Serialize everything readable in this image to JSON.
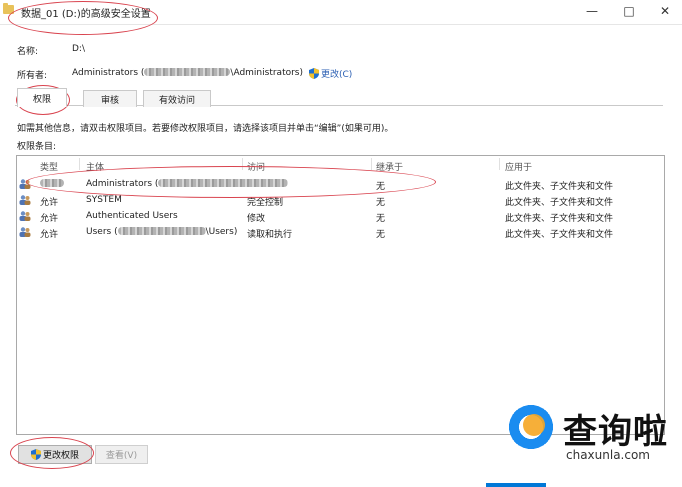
{
  "window": {
    "title": "数据_01 (D:)的高级安全设置",
    "minimize": "—",
    "maximize": "□",
    "close": "✕"
  },
  "info": {
    "name_label": "名称:",
    "name_value": "D:\\",
    "owner_label": "所有者:",
    "owner_prefix": "Administrators (",
    "owner_suffix": "\\Administrators)",
    "change_link": "更改(C)"
  },
  "tabs": [
    {
      "label": "权限",
      "active": true
    },
    {
      "label": "审核",
      "active": false
    },
    {
      "label": "有效访问",
      "active": false
    }
  ],
  "hint": "如需其他信息，请双击权限项目。若要修改权限项目，请选择该项目并单击“编辑”(如果可用)。",
  "entries_label": "权限条目:",
  "columns": [
    "类型",
    "主体",
    "访问",
    "继承于",
    "应用于"
  ],
  "rows": [
    {
      "type": "",
      "principal": "Administrators (",
      "principal_suffix": "",
      "access": "",
      "inherited": "无",
      "applies": "此文件夹、子文件夹和文件"
    },
    {
      "type": "允许",
      "principal": "SYSTEM",
      "principal_suffix": "",
      "access": "完全控制",
      "inherited": "无",
      "applies": "此文件夹、子文件夹和文件"
    },
    {
      "type": "允许",
      "principal": "Authenticated Users",
      "principal_suffix": "",
      "access": "修改",
      "inherited": "无",
      "applies": "此文件夹、子文件夹和文件"
    },
    {
      "type": "允许",
      "principal": "Users (",
      "principal_suffix": "\\Users)",
      "access": "读取和执行",
      "inherited": "无",
      "applies": "此文件夹、子文件夹和文件"
    }
  ],
  "buttons": {
    "change_permissions": "更改权限",
    "view": "查看(V)"
  },
  "watermark": {
    "text": "查询啦",
    "sub": "chaxunla.com"
  },
  "colors": {
    "annotation": "#d9444f",
    "link": "#2b5fb3",
    "shield_blue": "#1e6fd0",
    "shield_yellow": "#f2c12e"
  }
}
